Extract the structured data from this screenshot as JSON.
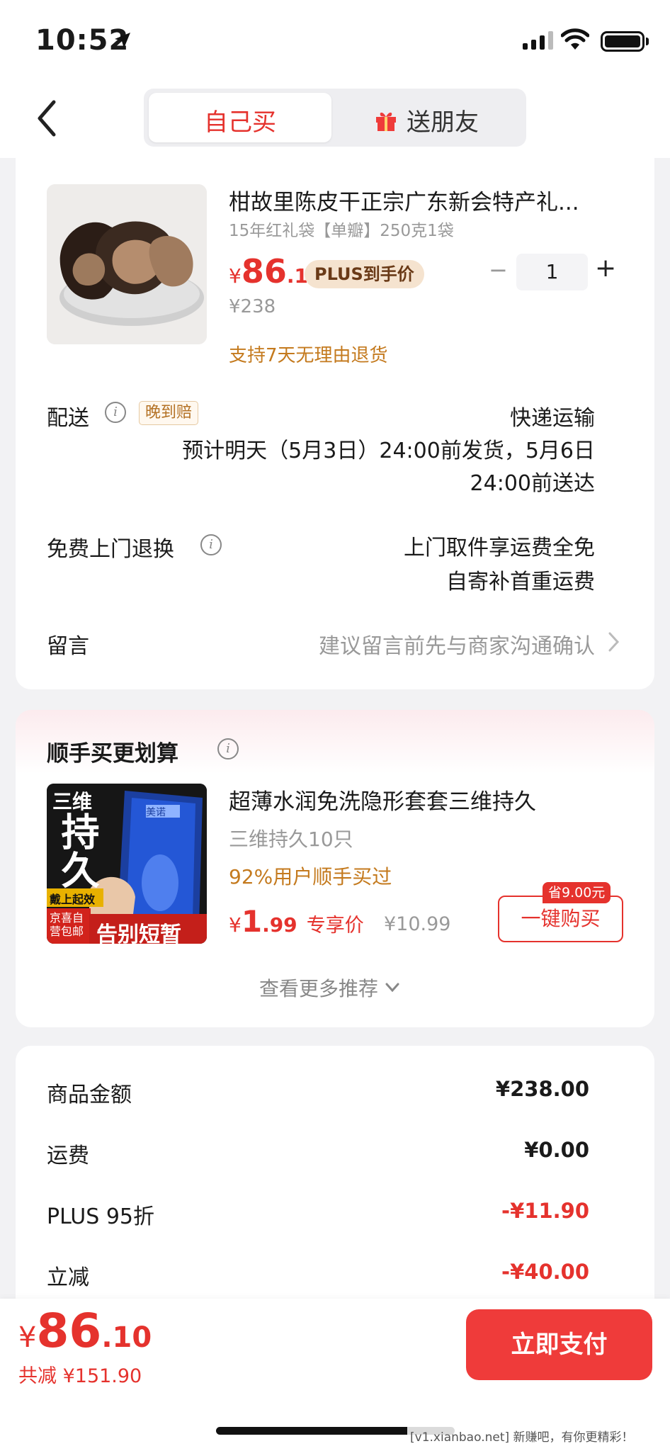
{
  "status_bar": {
    "time": "10:52"
  },
  "header": {
    "tab_self": "自己买",
    "tab_friend": "送朋友"
  },
  "product": {
    "title": "柑故里陈皮干正宗广东新会特产礼...",
    "spec": "15年红礼袋【单瓣】250克1袋",
    "price_symbol": "¥",
    "price_int": "86",
    "price_dec": ".1",
    "plus_tag": "PLUS到手价",
    "original_price": "¥238",
    "quantity": "1",
    "qty_minus": "−",
    "qty_plus": "+",
    "return_policy": "支持7天无理由退货"
  },
  "delivery": {
    "label": "配送",
    "late_tag": "晚到赔",
    "method": "快递运输",
    "estimate_line1": "预计明天（5月3日）24:00前发货，5月6日",
    "estimate_line2": "24:00前送达"
  },
  "free_return": {
    "label": "免费上门退换",
    "line1": "上门取件享运费全免",
    "line2": "自寄补首重运费"
  },
  "message": {
    "label": "留言",
    "placeholder": "建议留言前先与商家沟通确认"
  },
  "recommend": {
    "section_title": "顺手买更划算",
    "item_title": "超薄水润免洗隐形套套三维持久",
    "item_spec": "三维持久10只",
    "item_stat": "92%用户顺手买过",
    "price_symbol": "¥",
    "price_int": "1",
    "price_dec": ".99",
    "exclusive_label": "专享价",
    "original_price": "¥10.99",
    "save_badge": "省9.00元",
    "buy_button": "一键购买",
    "more_label": "查看更多推荐",
    "img_text_top": "三维",
    "img_text_big": "持久",
    "img_text_brand": "美诺",
    "img_text_badge": "戴上起效",
    "img_text_left": "京喜自营包邮",
    "img_text_bottom": "告别短暂"
  },
  "summary": {
    "rows": [
      {
        "label": "商品金额",
        "value": "¥238.00",
        "red": false
      },
      {
        "label": "运费",
        "value": "¥0.00",
        "red": false
      },
      {
        "label": "PLUS 95折",
        "value": "-¥11.90",
        "red": true
      },
      {
        "label": "立减",
        "value": "-¥40.00",
        "red": true
      }
    ]
  },
  "bottom": {
    "price_symbol": "¥",
    "price_int": "86",
    "price_dec": ".10",
    "total_saved": "共减 ¥151.90",
    "pay_button": "立即支付"
  },
  "watermark": "[v1.xianbao.net] 新赚吧，有你更精彩！",
  "colors": {
    "accent": "#e5322d",
    "gold": "#c47a1e",
    "bg": "#f2f2f4"
  }
}
